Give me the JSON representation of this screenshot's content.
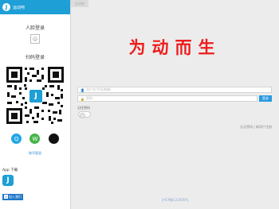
{
  "sidebar": {
    "logo_glyph": "J",
    "brand": "运动吧",
    "face_login_title": "人脸登录",
    "face_icon_glyph": "☺",
    "qr_login_title": "扫码登录",
    "qr_center_glyph": "J",
    "social": [
      {
        "name": "qq",
        "glyph": "Q",
        "color": "#21a6e6"
      },
      {
        "name": "wechat",
        "glyph": "W",
        "color": "#47b549"
      },
      {
        "name": "apple",
        "glyph": "",
        "color": "#111111"
      }
    ],
    "account_login_link": "账号登录",
    "app_download_label": "App 下载",
    "app_icon_glyph": "J",
    "join_badge": "加入我们"
  },
  "top_tab": "运动吧",
  "slogan": "为动而生",
  "form": {
    "username_placeholder": "用户名/手机/邮箱",
    "password_placeholder": "密码",
    "login_button": "登录",
    "remember_label": "记住密码",
    "bottom_links": "忘记密码 | 新用户注册"
  },
  "footer": "沪ICP备123456号",
  "colors": {
    "primary": "#1e9fd6",
    "slogan": "#ee1c1c",
    "button": "#2b9ae0"
  }
}
